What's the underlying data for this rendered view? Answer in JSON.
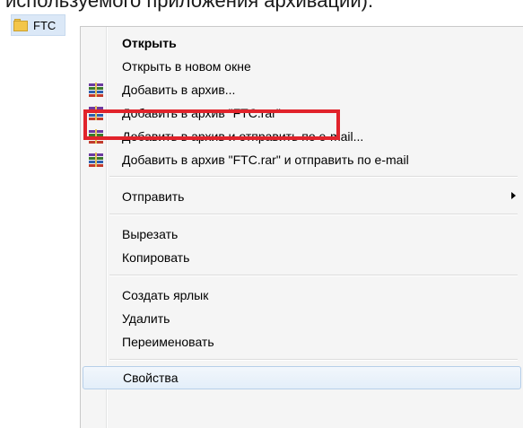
{
  "caption": "используемого приложения архивации).",
  "folder": {
    "name": "FTC"
  },
  "menu": {
    "items": [
      {
        "label": "Открыть"
      },
      {
        "label": "Открыть в новом окне"
      },
      {
        "label": "Добавить в архив..."
      },
      {
        "label": "Добавить в архив \"FTC.rar\""
      },
      {
        "label": "Добавить в архив и отправить по e-mail..."
      },
      {
        "label": "Добавить в архив \"FTC.rar\" и отправить по e-mail"
      },
      {
        "label": "Отправить"
      },
      {
        "label": "Вырезать"
      },
      {
        "label": "Копировать"
      },
      {
        "label": "Создать ярлык"
      },
      {
        "label": "Удалить"
      },
      {
        "label": "Переименовать"
      },
      {
        "label": "Свойства"
      }
    ]
  },
  "colors": {
    "highlight": "#e1232b",
    "hover": "#dbe8f7"
  }
}
